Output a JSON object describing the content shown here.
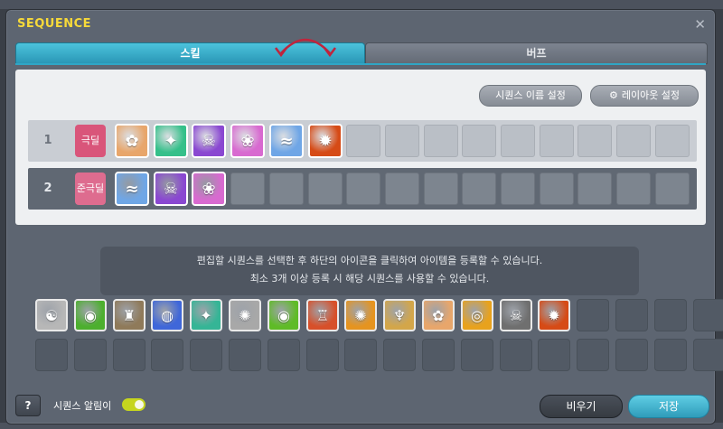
{
  "window": {
    "title": "SEQUENCE",
    "close_glyph": "✕"
  },
  "tabs": [
    {
      "label": "스킬",
      "active": true
    },
    {
      "label": "버프",
      "active": false
    }
  ],
  "toolbar": {
    "rename_label": "시퀀스 이름 설정",
    "layout_label": "레이아웃 설정"
  },
  "sequences": [
    {
      "number": "1",
      "name": "극딜",
      "selected": false,
      "icons": [
        {
          "icon": "fairy-girl-icon",
          "color": "#e8a66b",
          "glyph": "✿"
        },
        {
          "icon": "green-rune-icon",
          "color": "#35c08a",
          "glyph": "✦"
        },
        {
          "icon": "purple-skull-icon",
          "color": "#8a48d1",
          "glyph": "☠"
        },
        {
          "icon": "pink-spiral-icon",
          "color": "#d86ad0",
          "glyph": "❀"
        },
        {
          "icon": "blue-wave-icon",
          "color": "#6fa6e6",
          "glyph": "≈"
        },
        {
          "icon": "red-flame-icon",
          "color": "#d64b16",
          "glyph": "✹"
        }
      ],
      "empty_slots": 9
    },
    {
      "number": "2",
      "name": "준극딜",
      "selected": true,
      "icons": [
        {
          "icon": "blue-wave-icon",
          "color": "#6fa6e6",
          "glyph": "≈"
        },
        {
          "icon": "purple-skull-icon",
          "color": "#8a48d1",
          "glyph": "☠"
        },
        {
          "icon": "pink-spiral-icon",
          "color": "#d86ad0",
          "glyph": "❀"
        }
      ],
      "empty_slots": 12
    }
  ],
  "info": {
    "line1": "편집할 시퀀스를 선택한 후 하단의 아이콘을 클릭하여 아이템을 등록할 수 있습니다.",
    "line2": "최소 3개 이상 등록 시 해당 시퀀스를 사용할 수 있습니다."
  },
  "palette": {
    "icons": [
      {
        "icon": "gray-dragon-icon",
        "color": "#b7b7b7",
        "glyph": "☯"
      },
      {
        "icon": "green-eye-icon",
        "color": "#4caf2e",
        "glyph": "◉"
      },
      {
        "icon": "bronze-figure-icon",
        "color": "#8f7a5a",
        "glyph": "♜"
      },
      {
        "icon": "blue-orb-icon",
        "color": "#3f67d9",
        "glyph": "◍"
      },
      {
        "icon": "teal-rune-icon",
        "color": "#35b596",
        "glyph": "✦"
      },
      {
        "icon": "silver-swirl-icon",
        "color": "#a8a8a8",
        "glyph": "✺"
      },
      {
        "icon": "lime-eye-icon",
        "color": "#5fbb27",
        "glyph": "◉"
      },
      {
        "icon": "red-castle-icon",
        "color": "#d7502a",
        "glyph": "♖"
      },
      {
        "icon": "orange-seal-icon",
        "color": "#e59420",
        "glyph": "✺"
      },
      {
        "icon": "golden-hair-icon",
        "color": "#d3a64a",
        "glyph": "♆"
      },
      {
        "icon": "fairy-girl-icon",
        "color": "#e8a66b",
        "glyph": "✿"
      },
      {
        "icon": "gold-coin-icon",
        "color": "#e8a21d",
        "glyph": "◎"
      },
      {
        "icon": "skull-spirit-icon",
        "color": "#6f6f6f",
        "glyph": "☠"
      },
      {
        "icon": "red-flame-icon",
        "color": "#d64b16",
        "glyph": "✹"
      }
    ],
    "empty_slots_row1": 4,
    "empty_slots_row2": 18
  },
  "footer": {
    "help_label": "?",
    "alarm_label": "시퀀스 알림이",
    "alarm_on": true,
    "clear_label": "비우기",
    "save_label": "저장"
  }
}
